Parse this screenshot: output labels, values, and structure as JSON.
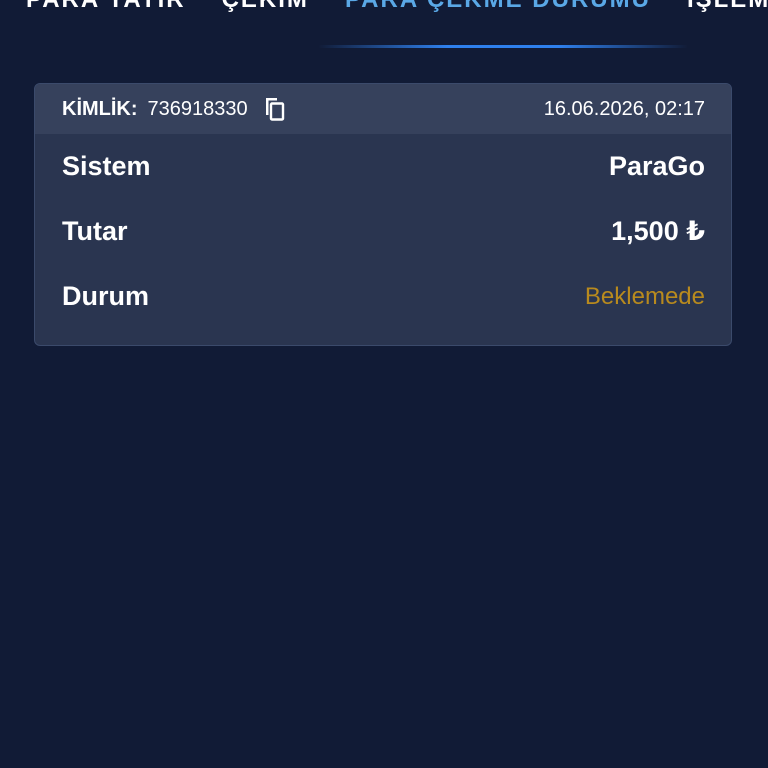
{
  "tabs": [
    {
      "label": "PARA YATIR",
      "active": false
    },
    {
      "label": "ÇEKİM",
      "active": false
    },
    {
      "label": "PARA ÇEKME DURUMU",
      "active": true
    },
    {
      "label": "İŞLEM",
      "active": false
    }
  ],
  "card": {
    "id_label": "KİMLİK:",
    "id_value": "736918330",
    "date": "16.06.2026, 02:17",
    "rows": [
      {
        "label": "Sistem",
        "value": "ParaGo"
      },
      {
        "label": "Tutar",
        "value": "1,500 ₺"
      },
      {
        "label": "Durum",
        "value": "Beklemede"
      }
    ]
  },
  "colors": {
    "background": "#111b36",
    "card": "#2a3550",
    "card_header": "#36415c",
    "active_tab": "#5aa8e6",
    "pending": "#b88a1e"
  },
  "icons": {
    "copy": "copy-icon"
  }
}
